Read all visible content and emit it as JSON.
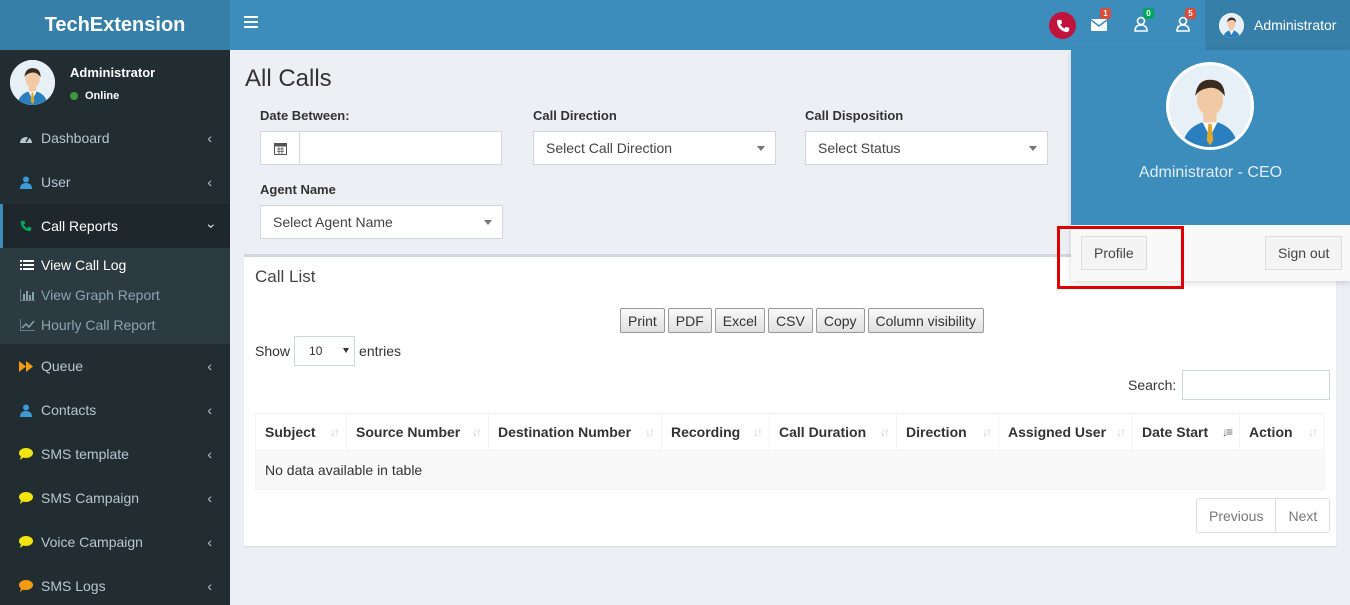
{
  "header": {
    "brand": "TechExtension",
    "user_name": "Administrator",
    "badges": {
      "messages": "1",
      "notifications": "0",
      "tasks": "5"
    },
    "colors": {
      "topbar": "#3c8dbc",
      "phone": "#c0143c",
      "badge_red": "#dd4b39",
      "badge_green": "#00a65a"
    }
  },
  "sidebar": {
    "user_name": "Administrator",
    "status": "Online",
    "items": [
      {
        "label": "Dashboard",
        "icon": "dashboard-icon"
      },
      {
        "label": "User",
        "icon": "user-icon"
      },
      {
        "label": "Call Reports",
        "icon": "phone-icon"
      },
      {
        "label": "Queue",
        "icon": "forward-icon"
      },
      {
        "label": "Contacts",
        "icon": "user-icon"
      },
      {
        "label": "SMS template",
        "icon": "comment-icon"
      },
      {
        "label": "SMS Campaign",
        "icon": "comment-icon"
      },
      {
        "label": "Voice Campaign",
        "icon": "comment-icon"
      },
      {
        "label": "SMS Logs",
        "icon": "comment-icon"
      }
    ],
    "submenu": [
      {
        "label": "View Call Log",
        "icon": "list-icon"
      },
      {
        "label": "View Graph Report",
        "icon": "bar-chart-icon"
      },
      {
        "label": "Hourly Call Report",
        "icon": "line-chart-icon"
      }
    ]
  },
  "page": {
    "title": "All Calls",
    "filters": {
      "date_label": "Date Between:",
      "date_value": "",
      "direction_label": "Call Direction",
      "direction_value": "Select Call Direction",
      "disposition_label": "Call Disposition",
      "disposition_value": "Select Status",
      "agent_label": "Agent Name",
      "agent_value": "Select Agent Name"
    },
    "call_list": {
      "title": "Call List",
      "buttons": [
        "Print",
        "PDF",
        "Excel",
        "CSV",
        "Copy",
        "Column visibility"
      ],
      "show_label": "Show",
      "entries_value": "10",
      "entries_label": "entries",
      "search_label": "Search:",
      "search_value": "",
      "columns": [
        "Subject",
        "Source Number",
        "Destination Number",
        "Recording",
        "Call Duration",
        "Direction",
        "Assigned User",
        "Date Start",
        "Action"
      ],
      "empty_message": "No data available in table",
      "pager": {
        "previous": "Previous",
        "next": "Next"
      }
    }
  },
  "dropdown": {
    "title": "Administrator - CEO",
    "profile_button": "Profile",
    "signout_button": "Sign out"
  }
}
